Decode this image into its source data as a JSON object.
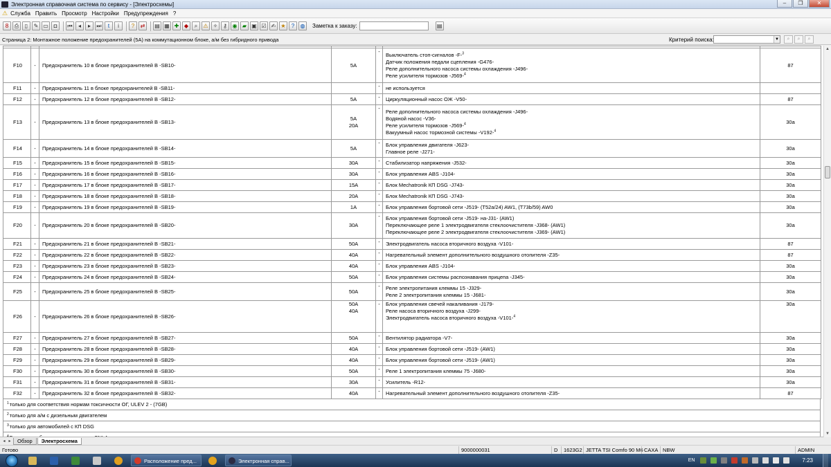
{
  "window": {
    "title": "Электронная справочная система по сервису - [Электросхемы]"
  },
  "menu": [
    "Служба",
    "Править",
    "Просмотр",
    "Настройки",
    "Предупреждения",
    "?"
  ],
  "toolbar": {
    "order_label": "Заметка к заказу:",
    "order_value": "",
    "icons": [
      {
        "name": "bag-icon",
        "glyph": "8",
        "cls": "c1"
      },
      {
        "name": "print-icon",
        "glyph": "⎙",
        "cls": ""
      },
      {
        "name": "document-icon",
        "glyph": "▯",
        "cls": ""
      },
      {
        "name": "edit-icon",
        "glyph": "✎",
        "cls": ""
      },
      {
        "name": "car-icon",
        "glyph": "▭",
        "cls": ""
      },
      {
        "name": "vehicle-icon",
        "glyph": "◘",
        "cls": ""
      },
      {
        "name": "first-icon",
        "glyph": "⏮",
        "cls": ""
      },
      {
        "name": "prev-icon",
        "glyph": "◂",
        "cls": ""
      },
      {
        "name": "next-icon",
        "glyph": "▸",
        "cls": ""
      },
      {
        "name": "last-icon",
        "glyph": "⏭",
        "cls": ""
      },
      {
        "name": "link-icon",
        "glyph": "t",
        "cls": "c2"
      },
      {
        "name": "info-icon",
        "glyph": "i",
        "cls": ""
      },
      {
        "name": "help-icon",
        "glyph": "?",
        "cls": "c4"
      },
      {
        "name": "refresh-icon",
        "glyph": "⇄",
        "cls": "c1"
      },
      {
        "name": "book-icon",
        "glyph": "▤",
        "cls": ""
      },
      {
        "name": "grid-icon",
        "glyph": "▦",
        "cls": ""
      },
      {
        "name": "tool-icon",
        "glyph": "✚",
        "cls": "c3"
      },
      {
        "name": "stop-icon",
        "glyph": "◆",
        "cls": "c1"
      },
      {
        "name": "search-icon",
        "glyph": "⌕",
        "cls": ""
      },
      {
        "name": "warning-icon",
        "glyph": "⚠",
        "cls": "c4"
      },
      {
        "name": "wrench-icon",
        "glyph": "✧",
        "cls": ""
      },
      {
        "name": "key-icon",
        "glyph": "⚷",
        "cls": ""
      },
      {
        "name": "eye-icon",
        "glyph": "◉",
        "cls": "c3"
      },
      {
        "name": "truck-icon",
        "glyph": "▰",
        "cls": "c3"
      },
      {
        "name": "calc-icon",
        "glyph": "▣",
        "cls": ""
      },
      {
        "name": "checklist-icon",
        "glyph": "☑",
        "cls": ""
      },
      {
        "name": "note-icon",
        "glyph": "✍",
        "cls": ""
      },
      {
        "name": "badge-icon",
        "glyph": "★",
        "cls": "c4"
      },
      {
        "name": "question-icon",
        "glyph": "?",
        "cls": "c2"
      },
      {
        "name": "globe-icon",
        "glyph": "◍",
        "cls": "c2"
      }
    ]
  },
  "page": {
    "title": "Страница 2: Монтажное положение предохранителей (5A) на коммутационном блоке, а/м без гибридного привода",
    "search_label": "Критерий поиска:",
    "search_value": ""
  },
  "table": {
    "rows": [
      {
        "id": "F10",
        "desc": "Предохранитель 10 в блоке предохранителей B -SB10-",
        "amps": [
          "5A"
        ],
        "components": [
          "Выключатель стоп-сигналов -F-<sup>3</sup>",
          "Датчик положения педали сцепления -G476-",
          "Реле дополнительного насоса системы охлаждения -J496-",
          "Реле усилителя тормозов -J569-<sup>4</sup>"
        ],
        "terminal": "87"
      },
      {
        "id": "F11",
        "desc": "Предохранитель 11 в блоке предохранителей B -SB11-",
        "amps": [
          ""
        ],
        "components": [
          "не используется"
        ],
        "terminal": ""
      },
      {
        "id": "F12",
        "desc": "Предохранитель 12 в блоке предохранителей B -SB12-",
        "amps": [
          "5A"
        ],
        "components": [
          "Циркуляционный насос ОЖ -V50-"
        ],
        "terminal": "87"
      },
      {
        "id": "F13",
        "desc": "Предохранитель 13 в блоке предохранителей B -SB13-",
        "amps": [
          "5A",
          "",
          "20A",
          ""
        ],
        "components": [
          "Реле дополнительного насоса системы охлаждения -J496-",
          "Водяной насос -V36-",
          "Реле усилителя тормозов -J569-<sup>4</sup>",
          "Вакуумный насос тормозной системы -V192-<sup>4</sup>"
        ],
        "terminal": "30a"
      },
      {
        "id": "F14",
        "desc": "Предохранитель 14 в блоке предохранителей B -SB14-",
        "amps": [
          "5A"
        ],
        "components": [
          "Блок управления двигателя -J623-",
          "Главное реле -J271-"
        ],
        "terminal": "30a"
      },
      {
        "id": "F15",
        "desc": "Предохранитель 15 в блоке предохранителей B -SB15-",
        "amps": [
          "30A"
        ],
        "components": [
          "Стабилизатор напряжения -J532-"
        ],
        "terminal": "30a"
      },
      {
        "id": "F16",
        "desc": "Предохранитель 16 в блоке предохранителей B -SB16-",
        "amps": [
          "30A"
        ],
        "components": [
          "Блок управления ABS -J104-"
        ],
        "terminal": "30a"
      },
      {
        "id": "F17",
        "desc": "Предохранитель 17 в блоке предохранителей B -SB17-",
        "amps": [
          "15A"
        ],
        "components": [
          "Блок Mechatronik КП DSG -J743-"
        ],
        "terminal": "30a"
      },
      {
        "id": "F18",
        "desc": "Предохранитель 18 в блоке предохранителей B -SB18-",
        "amps": [
          "20A"
        ],
        "components": [
          "Блок Mechatronik КП DSG -J743-"
        ],
        "terminal": "30a"
      },
      {
        "id": "F19",
        "desc": "Предохранитель 19 в блоке предохранителей B -SB19-",
        "amps": [
          "1A"
        ],
        "components": [
          "Блок управления бортовой сети -J519- (T52a/24) AW1, (T73b/59) AW0"
        ],
        "terminal": "30a"
      },
      {
        "id": "F20",
        "desc": "Предохранитель 20 в блоке предохранителей B -SB20-",
        "amps": [
          "30A"
        ],
        "components": [
          "Блок управления бортовой сети -J519- на-J31- (AW1)",
          "Переключающее реле 1 электродвигателя стеклоочистителя -J368- (AW1)",
          "Переключающее реле 2 электродвигателя стеклоочистителя -J369- (AW1)"
        ],
        "terminal": "30a"
      },
      {
        "id": "F21",
        "desc": "Предохранитель 21 в блоке предохранителей B -SB21-",
        "amps": [
          "50A"
        ],
        "components": [
          "Электродвигатель насоса вторичного воздуха -V101-"
        ],
        "terminal": "87"
      },
      {
        "id": "F22",
        "desc": "Предохранитель 22 в блоке предохранителей B -SB22-",
        "amps": [
          "40A"
        ],
        "components": [
          "Нагревательный элемент дополнительного воздушного отопителя -Z35-"
        ],
        "terminal": "87"
      },
      {
        "id": "F23",
        "desc": "Предохранитель 23 в блоке предохранителей B -SB23-",
        "amps": [
          "40A"
        ],
        "components": [
          "Блок управления ABS -J104-"
        ],
        "terminal": "30a"
      },
      {
        "id": "F24",
        "desc": "Предохранитель 24 в блоке предохранителей B -SB24-",
        "amps": [
          "50A"
        ],
        "components": [
          "Блок управления системы распознавания прицепа -J345-"
        ],
        "terminal": "30a"
      },
      {
        "id": "F25",
        "desc": "Предохранитель 25 в блоке предохранителей B -SB25-",
        "amps": [
          "50A"
        ],
        "components": [
          "Реле электропитания клеммы 15 -J329-",
          "Реле 2 электропитания клеммы 15 -J681-"
        ],
        "terminal": "30a"
      },
      {
        "id": "F26",
        "desc": "Предохранитель 26 в блоке предохранителей B -SB26-",
        "amps": [
          "50A",
          "40A",
          "",
          ""
        ],
        "components": [
          "Блок управления свечей накаливания -J179-",
          "Реле насоса вторичного воздуха -J299-",
          "Электродвигатель насоса вторичного воздуха -V101-<sup>4</sup>",
          ""
        ],
        "terminal": "30a"
      },
      {
        "id": "F27",
        "desc": "Предохранитель 27 в блоке предохранителей B -SB27-",
        "amps": [
          "50A"
        ],
        "components": [
          "Вентилятор радиатора -V7-"
        ],
        "terminal": "30a"
      },
      {
        "id": "F28",
        "desc": "Предохранитель 28 в блоке предохранителей B -SB28-",
        "amps": [
          "40A"
        ],
        "components": [
          "Блок управления бортовой сети -J519- (AW1)"
        ],
        "terminal": "30a"
      },
      {
        "id": "F29",
        "desc": "Предохранитель 29 в блоке предохранителей B -SB29-",
        "amps": [
          "40A"
        ],
        "components": [
          "Блок управления бортовой сети -J519- (AW1)"
        ],
        "terminal": "30a"
      },
      {
        "id": "F30",
        "desc": "Предохранитель 30 в блоке предохранителей B -SB30-",
        "amps": [
          "50A"
        ],
        "components": [
          "Реле 1 электропитания клеммы 75 -J680-"
        ],
        "terminal": "30a"
      },
      {
        "id": "F31",
        "desc": "Предохранитель 31 в блоке предохранителей B -SB31-",
        "amps": [
          "30A"
        ],
        "components": [
          "Усилитель -R12-"
        ],
        "terminal": "30a"
      },
      {
        "id": "F32",
        "desc": "Предохранитель 32 в блоке предохранителей B -SB32-",
        "amps": [
          "40A"
        ],
        "components": [
          "Нагревательный элемент дополнительного воздушного отопителя -Z35-"
        ],
        "terminal": "87"
      }
    ],
    "notes": [
      {
        "n": "1",
        "text": "только для соответствия нормам токсичности ОГ, ULEV 2 - (7GB)"
      },
      {
        "n": "2",
        "text": "только для а/м с дизельным двигателем"
      },
      {
        "n": "3",
        "text": "только для автомобилей с КП DSG"
      },
      {
        "n": "4",
        "text": "Буквенное обозначение двигателя CNLA"
      }
    ]
  },
  "tabs": [
    {
      "label": "Обзор",
      "active": false
    },
    {
      "label": "Электросхема",
      "active": true
    }
  ],
  "status": {
    "ready": "Готово",
    "order_no": "9000000031",
    "d": "D",
    "code": "1623G2",
    "model": "JETTA TSI Comfo 90 M6",
    "engine": "CAXA",
    "trans": "NBW",
    "user": "ADMIN"
  },
  "taskbar": {
    "tasks": [
      {
        "label": "Расположение пред...",
        "color": "#d23a2a"
      },
      {
        "label": "",
        "color": "#e3a31d"
      },
      {
        "label": "Электронная справ...",
        "color": "#2c2c44"
      }
    ],
    "lang": "EN",
    "time": "7:23"
  }
}
